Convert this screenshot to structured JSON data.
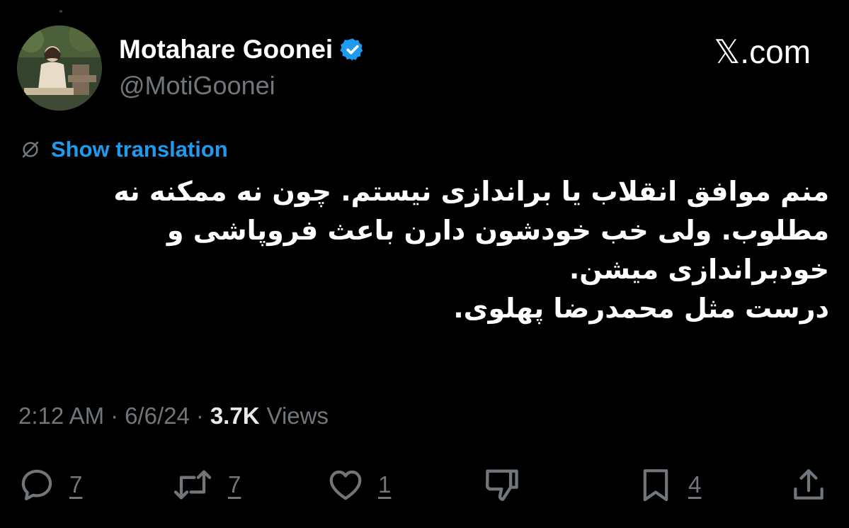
{
  "tweet": {
    "author": {
      "display_name": "Motahare Goonei",
      "handle": "@MotiGoonei",
      "verified": true
    },
    "brand": "𝕏.com",
    "show_translation": "Show translation",
    "text_lines": [
      "منم موافق انقلاب یا براندازی نیستم. چون نه ممکنه نه",
      "مطلوب. ولی خب خودشون دارن باعث فروپاشی و",
      "خودبراندازی میشن.",
      "درست مثل محمدرضا پهلوی."
    ],
    "meta": {
      "time": "2:12 AM",
      "separator": "·",
      "date": "6/6/24",
      "views_count": "3.7K",
      "views_label": "Views"
    },
    "actions": {
      "reply": {
        "icon": "reply-icon",
        "count": "7"
      },
      "retweet": {
        "icon": "retweet-icon",
        "count": "7"
      },
      "like": {
        "icon": "heart-icon",
        "count": "1"
      },
      "dislike": {
        "icon": "thumbs-down-icon",
        "count": ""
      },
      "bookmark": {
        "icon": "bookmark-icon",
        "count": "4"
      },
      "share": {
        "icon": "share-icon",
        "count": ""
      }
    }
  },
  "colors": {
    "background": "#000000",
    "primary_text": "#ffffff",
    "secondary_text": "#71767b",
    "accent": "#1d9bf0",
    "verified_badge": "#1d9bf0"
  }
}
